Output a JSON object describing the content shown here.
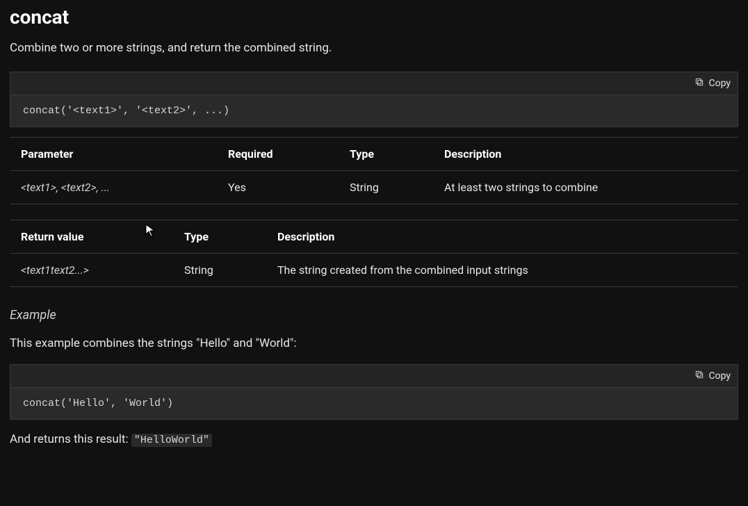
{
  "heading": "concat",
  "lead": "Combine two or more strings, and return the combined string.",
  "copy_label": "Copy",
  "syntax_code": "concat('<text1>', '<text2>', ...)",
  "param_table": {
    "headers": {
      "parameter": "Parameter",
      "required": "Required",
      "type": "Type",
      "description": "Description"
    },
    "rows": [
      {
        "parameter": "<text1>, <text2>, ...",
        "required": "Yes",
        "type": "String",
        "description": "At least two strings to combine"
      }
    ]
  },
  "return_table": {
    "headers": {
      "return_value": "Return value",
      "type": "Type",
      "description": "Description"
    },
    "rows": [
      {
        "return_value": "<text1text2...>",
        "type": "String",
        "description": "The string created from the combined input strings"
      }
    ]
  },
  "example": {
    "heading": "Example",
    "lead": "This example combines the strings \"Hello\" and \"World\":",
    "code": "concat('Hello', 'World')",
    "result_prefix": "And returns this result: ",
    "result_value": "\"HelloWorld\""
  }
}
